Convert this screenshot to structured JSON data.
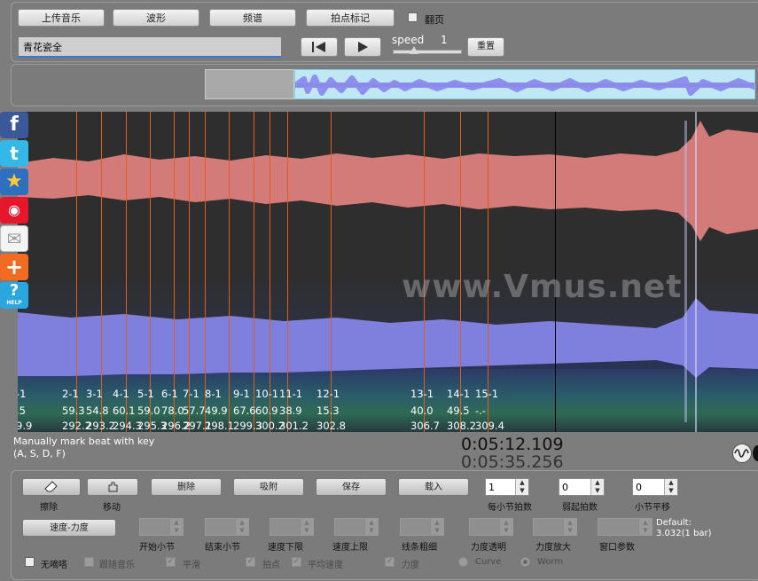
{
  "toolbar": {
    "upload_label": "上传音乐",
    "waveform_label": "波形",
    "spectrum_label": "频谱",
    "beat_mark_label": "拍点标记",
    "page_flip_label": "翻页",
    "song_title": "青花瓷全",
    "speed_label": "speed",
    "speed_value": "1",
    "reset_label": "重置"
  },
  "status": {
    "hint_line1": "Manually mark beat with key",
    "hint_line2": "(A, S, D, F)",
    "time_current": "0:05:12.109",
    "time_total": "0:05:35.256"
  },
  "beat_rows": {
    "labels": [
      "-1",
      "2-1",
      "3-1",
      "4-1",
      "5-1",
      "6-1",
      "7-1",
      "8-1",
      "9-1",
      "10-1",
      "11-1",
      "12-1",
      "13-1",
      "14-1",
      "15-1"
    ],
    "row2": [
      ".5",
      "59.3",
      "54.8",
      "60.1",
      "59.0",
      "78.0",
      "57.7",
      "49.9",
      "67.6",
      "60.9",
      "38.9",
      "15.3",
      "40.0",
      "49.5",
      "-.-"
    ],
    "row3": [
      "9.9",
      "292.2",
      "293.2",
      "294.3",
      "295.3",
      "296.2",
      "297.1",
      "298.1",
      "299.3",
      "300.2",
      "301.2",
      "302.8",
      "306.7",
      "308.2",
      "309.4"
    ]
  },
  "watermark": "www.Vmus.net",
  "social_icons": [
    "facebook-icon",
    "twitter-icon",
    "favorite-star-icon",
    "weibo-icon",
    "mail-icon",
    "add-plus-icon",
    "help-icon"
  ],
  "help_text": "HELP",
  "bottom": {
    "erase_label": "擦除",
    "move_label": "移动",
    "delete_label": "删除",
    "snap_label": "吸附",
    "save_label": "保存",
    "load_label": "载入",
    "beats_per_bar_value": "1",
    "beats_per_bar_label": "每小节拍数",
    "weak_beats_value": "0",
    "weak_beats_label": "弱起拍数",
    "bar_shift_value": "0",
    "bar_shift_label": "小节平移",
    "speed_force_label": "速度-力度",
    "start_bar_label": "开始小节",
    "end_bar_label": "结束小节",
    "speed_lower_label": "速度下限",
    "speed_upper_label": "速度上限",
    "line_thickness_label": "线条粗细",
    "force_transparency_label": "力度透明",
    "force_zoom_label": "力度放大",
    "window_param_label": "窗口参数",
    "default_label": "Default:",
    "default_value": "3.032(1 bar)",
    "no_ticks_label": "无嘀嗒",
    "follow_music_label": "跟随音乐",
    "smooth_label": "平滑",
    "beats_label": "拍点",
    "avg_speed_label": "平均速度",
    "force_label": "力度",
    "curve_label": "Curve",
    "worm_label": "Worm"
  },
  "colors": {
    "waveform_top": "#d27b78",
    "waveform_bottom": "#7f7fdd",
    "beat_line": "#e55a1d",
    "overview_wave": "#8f8ff0"
  }
}
